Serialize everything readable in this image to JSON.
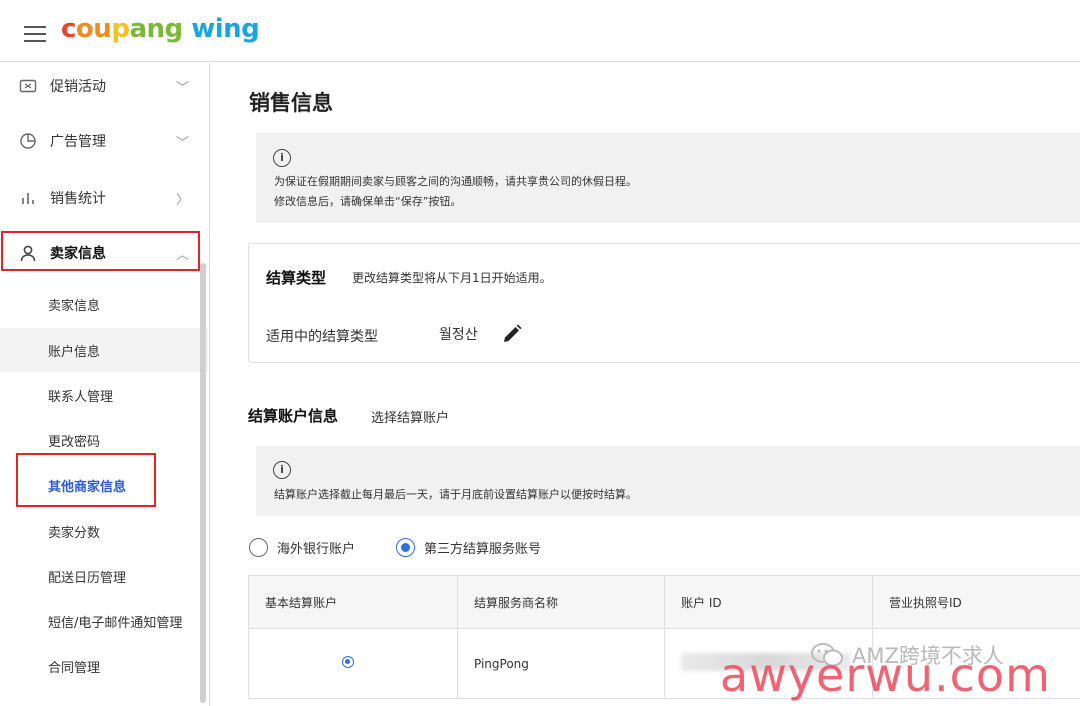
{
  "header": {
    "logo_coupang": "coupang",
    "logo_wing": "wing",
    "logo_colors": [
      "#e3452f",
      "#f28c21",
      "#f7c21f",
      "#7bb83a",
      "#19a5e0"
    ]
  },
  "sidebar": {
    "items": [
      {
        "label": "促销活动",
        "icon": "coupon-icon",
        "chevron": "chevron-down-icon"
      },
      {
        "label": "广告管理",
        "icon": "pie-chart-icon",
        "chevron": "chevron-down-icon"
      },
      {
        "label": "销售统计",
        "icon": "bar-chart-icon",
        "chevron": "chevron-right-icon"
      },
      {
        "label": "卖家信息",
        "icon": "person-icon",
        "chevron": "chevron-up-icon"
      }
    ],
    "subitems": [
      {
        "label": "卖家信息"
      },
      {
        "label": "账户信息"
      },
      {
        "label": "联系人管理"
      },
      {
        "label": "更改密码"
      },
      {
        "label": "其他商家信息"
      },
      {
        "label": "卖家分数"
      },
      {
        "label": "配送日历管理"
      },
      {
        "label": "短信/电子邮件通知管理"
      },
      {
        "label": "合同管理"
      }
    ],
    "active_color": "#2c5bdc",
    "highlight_color": "#e3222b"
  },
  "main": {
    "title": "销售信息",
    "notice1": {
      "line1": "为保证在假期期间卖家与顾客之间的沟通顺畅，请共享贵公司的休假日程。",
      "line2": "修改信息后，请确保单击“保存”按钮。"
    },
    "settlement": {
      "title": "结算类型",
      "desc": "更改结算类型将从下月1日开始适用。",
      "label": "适用中的结算类型",
      "value": "월정산"
    },
    "account": {
      "title": "结算账户信息",
      "subtitle": "选择结算账户",
      "notice": "结算账户选择截止每月最后一天，请于月底前设置结算账户以便按时结算。",
      "radios": [
        {
          "label": "海外银行账户",
          "checked": false
        },
        {
          "label": "第三方结算服务账号",
          "checked": true
        }
      ],
      "table": {
        "headers": [
          "基本结算账户",
          "结算服务商名称",
          "账户 ID",
          "营业执照号ID"
        ],
        "rows": [
          {
            "provider": "PingPong"
          }
        ]
      }
    }
  },
  "watermark": {
    "wechat_text": "AMZ跨境不求人",
    "site_text": "awyerwu.com"
  }
}
